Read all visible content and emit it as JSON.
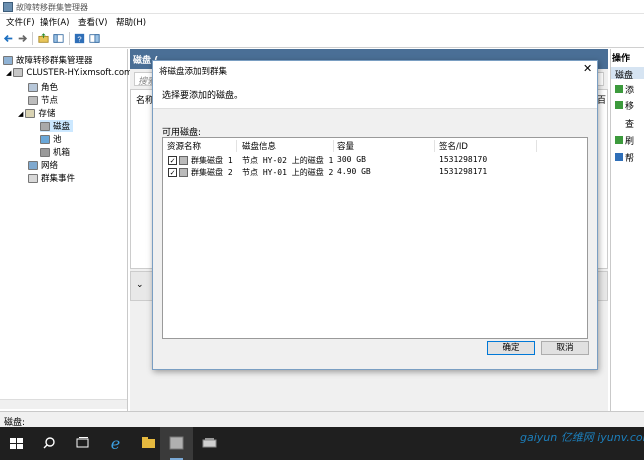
{
  "window": {
    "title": "故障转移群集管理器"
  },
  "menubar": {
    "items": [
      "文件(F)",
      "操作(A)",
      "查看(V)",
      "帮助(H)"
    ]
  },
  "tree": {
    "root": "故障转移群集管理器",
    "cluster": "CLUSTER-HY.ixmsoft.com",
    "nodes": [
      {
        "label": "角色"
      },
      {
        "label": "节点"
      },
      {
        "label": "存储"
      },
      {
        "label": "磁盘"
      },
      {
        "label": "池"
      },
      {
        "label": "机箱"
      },
      {
        "label": "网络"
      },
      {
        "label": "群集事件"
      }
    ]
  },
  "center": {
    "header": "磁盘 (",
    "search_placeholder": "搜索",
    "col_name": "名称",
    "col_right": "百"
  },
  "actions": {
    "header": "操作",
    "section": "磁盘",
    "items": [
      "添",
      "移",
      "查",
      "刷",
      "帮"
    ]
  },
  "dialog": {
    "title": "将磁盘添加到群集",
    "instruction": "选择要添加的磁盘。",
    "available_label": "可用磁盘:",
    "columns": [
      "资源名称",
      "磁盘信息",
      "容量",
      "签名/ID"
    ],
    "rows": [
      {
        "checked": true,
        "name": "群集磁盘 1",
        "info": "节点 HY-02 上的磁盘 1",
        "capacity": "300 GB",
        "sig": "1531298170"
      },
      {
        "checked": true,
        "name": "群集磁盘 2",
        "info": "节点 HY-01 上的磁盘 2",
        "capacity": "4.90 GB",
        "sig": "1531298171"
      }
    ],
    "ok": "确定",
    "cancel": "取消"
  },
  "statusbar": {
    "text": "磁盘:"
  },
  "watermark": {
    "text": "gaiyun 亿维网 iyunv.com"
  },
  "colors": {
    "accent": "#0078d7",
    "panel_header": "#4a6f96",
    "taskbar": "#1f1f1f"
  }
}
